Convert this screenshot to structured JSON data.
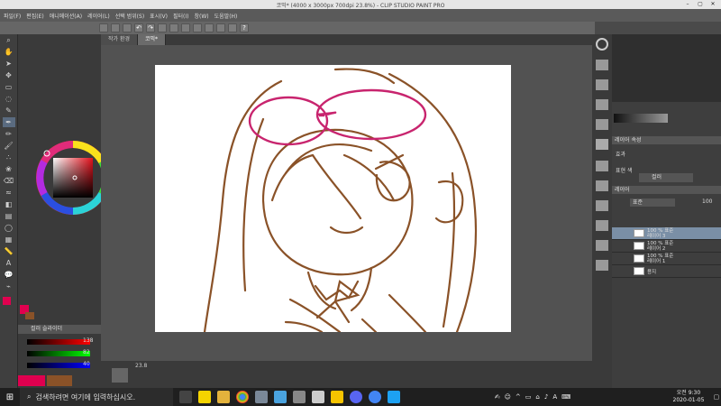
{
  "window": {
    "title": "코믹* (4000 x 3000px 700dpi 23.8%) - CLIP STUDIO PAINT PRO",
    "minimize": "–",
    "maximize": "▢",
    "close": "✕"
  },
  "menu": [
    "파일(F)",
    "편집(E)",
    "애니메이션(A)",
    "레이어(L)",
    "선택 범위(S)",
    "표시(V)",
    "필터(I)",
    "창(W)",
    "도움말(H)"
  ],
  "tabs": [
    {
      "label": "작가 환경"
    },
    {
      "label": "코믹*"
    }
  ],
  "right_panel": {
    "header1": "레이어 속성",
    "effect_label": "효과",
    "color_label": "표현 색",
    "color_value": "컬러",
    "layer_header": "레이어",
    "blend": "표준",
    "opacity": "100",
    "layers": [
      {
        "line1": "100 % 표준",
        "line2": "레이어 3"
      },
      {
        "line1": "100 % 표준",
        "line2": "레이어 2"
      },
      {
        "line1": "100 % 표준",
        "line2": "레이어 1"
      },
      {
        "line1": "",
        "line2": "용지"
      }
    ]
  },
  "color_slider": {
    "title": "컬러 슬라이더",
    "r": "138",
    "g": "82",
    "b": "40"
  },
  "subtool_values": {
    "a": "138",
    "b": "82",
    "c": "40"
  },
  "bottom_zoom": "23.8",
  "taskbar": {
    "search_placeholder": "검색하려면 여기에 입력하십시오.",
    "language": "A",
    "time": "오전 9:30",
    "date": "2020-01-05"
  },
  "colors": {
    "sketch_brown": "#8a5228",
    "glasses_magenta": "#c8246e",
    "accent_red": "#e0004f"
  }
}
